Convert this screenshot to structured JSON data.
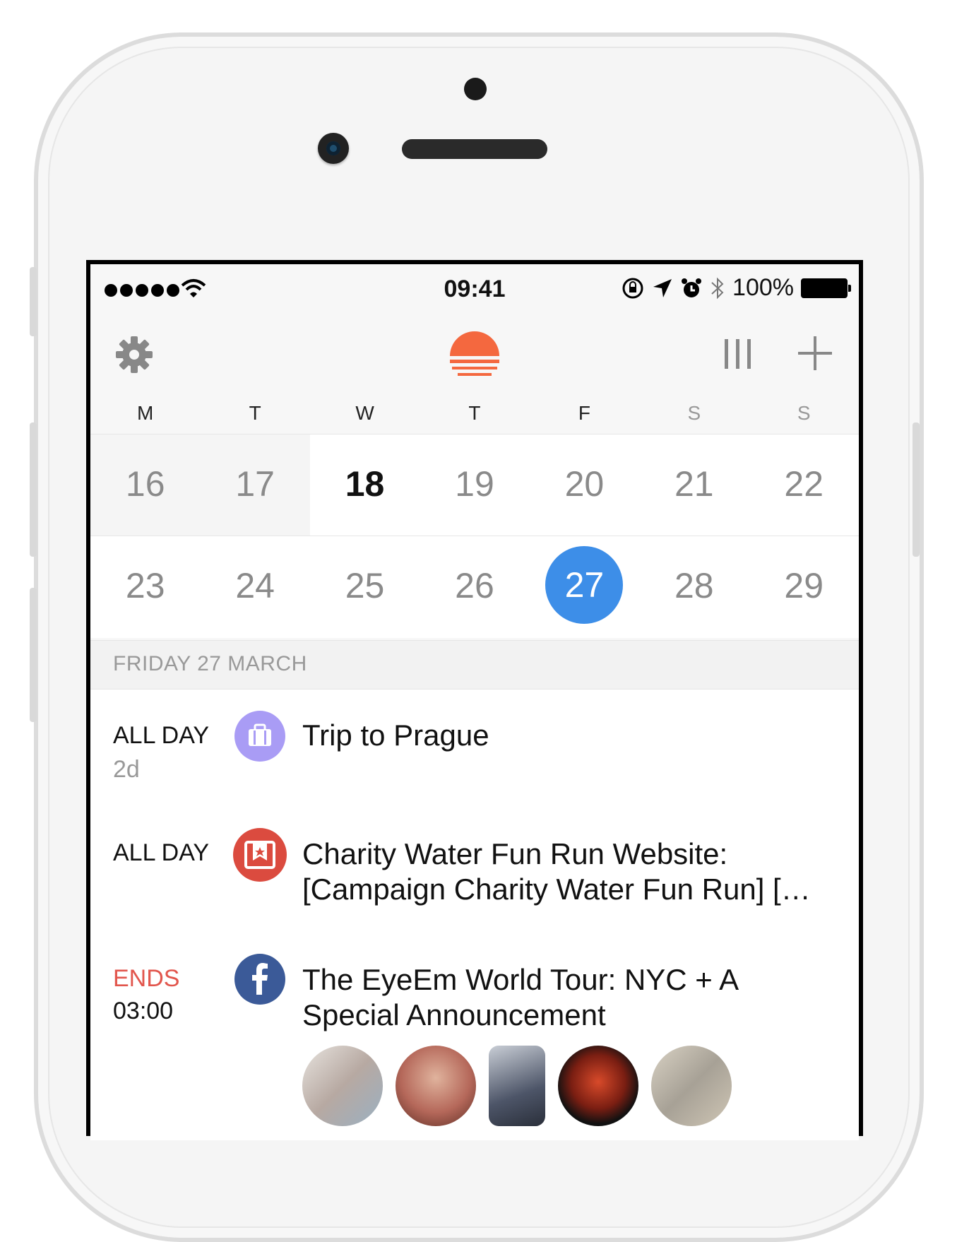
{
  "status_bar": {
    "time": "09:41",
    "battery": "100%"
  },
  "weekdays": [
    "M",
    "T",
    "W",
    "T",
    "F",
    "S",
    "S"
  ],
  "weeks": [
    [
      "16",
      "17",
      "18",
      "19",
      "20",
      "21",
      "22"
    ],
    [
      "23",
      "24",
      "25",
      "26",
      "27",
      "28",
      "29"
    ]
  ],
  "selected_day": "27",
  "today_day": "18",
  "day_header": "FRIDAY 27 MARCH",
  "events": [
    {
      "time": "ALL DAY",
      "sub": "2d",
      "title": "Trip to Prague",
      "icon": "suitcase-icon",
      "icon_color": "#a99cf5"
    },
    {
      "time": "ALL DAY",
      "sub": "",
      "title_line1": "Charity Water Fun Run Website:",
      "title_line2": "[Campaign Charity Water Fun Run] […",
      "icon": "wunderlist-icon",
      "icon_color": "#db4b3f"
    },
    {
      "time": "ENDS",
      "sub": "03:00",
      "title_line1": "The EyeEm World Tour: NYC + A",
      "title_line2": "Special Announcement",
      "icon": "facebook-icon",
      "icon_color": "#3b5a98"
    }
  ],
  "colors": {
    "accent": "#3d8ee8",
    "logo": "#f4683f",
    "ends": "#e2564d"
  }
}
